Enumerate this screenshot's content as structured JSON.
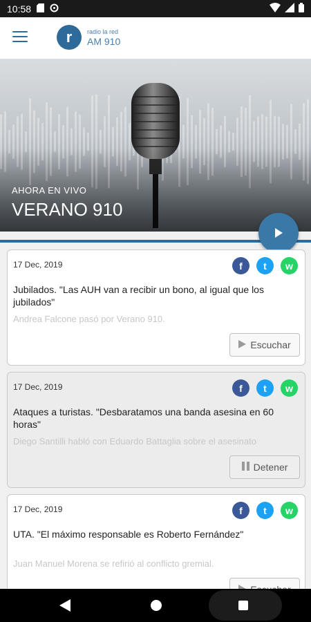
{
  "status_bar": {
    "time": "10:58",
    "icons": [
      "sd-card-icon",
      "sync-icon",
      "wifi-icon",
      "cellular-icon",
      "battery-icon"
    ]
  },
  "app_bar": {
    "logo_small": "radio la red",
    "logo_big": "AM 910",
    "logo_letter": "r"
  },
  "hero": {
    "live_label": "AHORA EN VIVO",
    "live_title": "VERANO 910"
  },
  "cards": [
    {
      "date": "17 Dec, 2019",
      "title": "Jubilados. \"Las AUH van a recibir un bono, al igual que los jubilados\"",
      "desc": "Andrea Falcone pasó por Verano 910.",
      "button": "Escuchar",
      "button_icon": "play-icon"
    },
    {
      "date": "17 Dec, 2019",
      "title": "Ataques a turistas. \"Desbaratamos una banda asesina en 60 horas\"",
      "desc": "Diego Santilli habló con Eduardo Battaglia sobre el asesinato",
      "button": "Detener",
      "button_icon": "pause-icon"
    },
    {
      "date": "17 Dec, 2019",
      "title": "UTA. \"El máximo responsable es Roberto Fernández\"",
      "desc": "Juan Manuel Morena se refirió al conflicto gremial.",
      "button": "Escuchar",
      "button_icon": "play-icon"
    }
  ],
  "share": {
    "facebook": "f",
    "twitter": "t",
    "whatsapp": "w"
  },
  "colors": {
    "brand_blue": "#2f6b9a",
    "facebook": "#3b5998",
    "twitter": "#1da1f2",
    "whatsapp": "#25d366"
  }
}
